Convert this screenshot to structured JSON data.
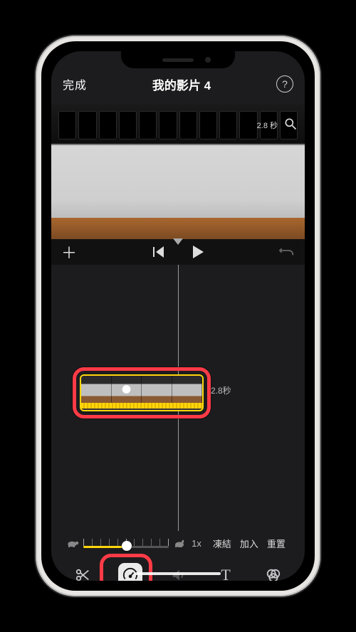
{
  "header": {
    "done": "完成",
    "title": "我的影片 4",
    "help_char": "?"
  },
  "preview": {
    "duration_overlay": "2.8 秒"
  },
  "transport": {
    "add_char": "＋"
  },
  "timeline": {
    "clip_duration": "2.8秒"
  },
  "speed": {
    "multiplier": "1x",
    "freeze": "凍結",
    "add": "加入",
    "reset": "重置"
  },
  "toolbar": {
    "text_glyph": "T"
  },
  "icons": {
    "help": "help-icon",
    "search": "search-icon",
    "add": "add-icon",
    "skip_back": "skip-back-icon",
    "play": "play-icon",
    "undo": "undo-icon",
    "turtle": "turtle-icon",
    "rabbit": "rabbit-icon",
    "scissors": "scissors-icon",
    "speedometer": "speedometer-icon",
    "volume": "volume-icon",
    "text": "text-icon",
    "filters": "filters-icon"
  }
}
